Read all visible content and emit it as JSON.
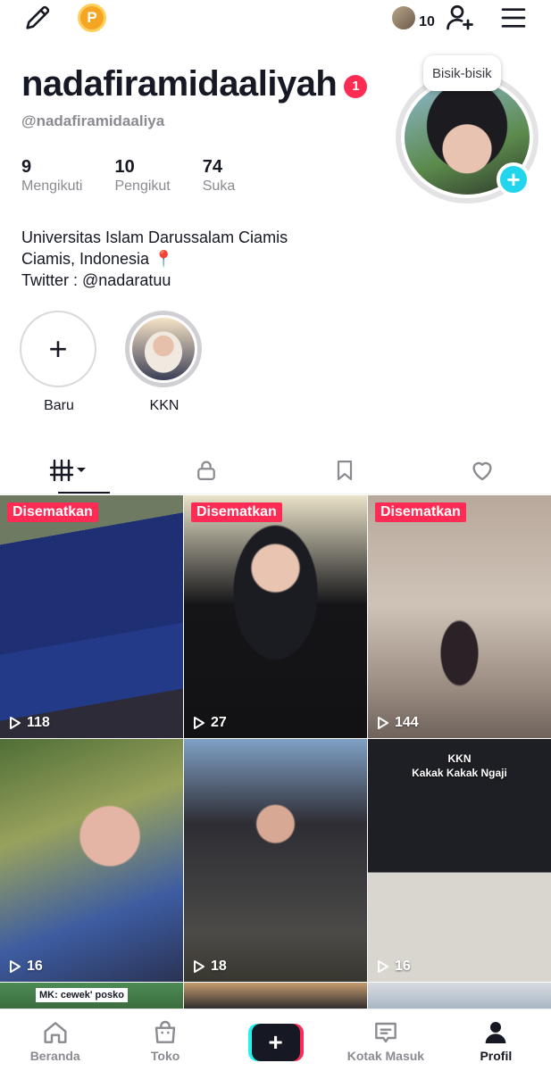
{
  "topbar": {
    "coin_letter": "P",
    "friends_count": "10"
  },
  "profile": {
    "username": "nadafiramidaaliyah",
    "username_badge": "1",
    "handle": "@nadafiramidaaliya",
    "bubble": "Bisik-bisik",
    "stats": [
      {
        "value": "9",
        "label": "Mengikuti"
      },
      {
        "value": "10",
        "label": "Pengikut"
      },
      {
        "value": "74",
        "label": "Suka"
      }
    ],
    "bio": [
      "Universitas Islam Darussalam Ciamis",
      "Ciamis, Indonesia 📍",
      "Twitter : @nadaratuu"
    ]
  },
  "highlights": [
    {
      "label": "Baru",
      "icon": "plus-icon"
    },
    {
      "label": "KKN",
      "icon": "photo"
    }
  ],
  "tabs": [
    "videos-grid-icon",
    "lock-icon",
    "bookmark-icon",
    "heart-icon"
  ],
  "videos": [
    {
      "pinned": "Disematkan",
      "views": "118",
      "overlay": ""
    },
    {
      "pinned": "Disematkan",
      "views": "27",
      "overlay": ""
    },
    {
      "pinned": "Disematkan",
      "views": "144",
      "overlay": ""
    },
    {
      "pinned": "",
      "views": "16",
      "overlay": ""
    },
    {
      "pinned": "",
      "views": "18",
      "overlay": ""
    },
    {
      "pinned": "",
      "views": "16",
      "overlay": "KKN\nKakak Kakak Ngaji"
    },
    {
      "pinned": "",
      "views": "",
      "overlay": "MK: cewek' posko"
    },
    {
      "pinned": "",
      "views": "",
      "overlay": ""
    },
    {
      "pinned": "",
      "views": "",
      "overlay": ""
    }
  ],
  "bottomnav": [
    {
      "label": "Beranda",
      "icon": "home-icon"
    },
    {
      "label": "Toko",
      "icon": "shop-bag-icon"
    },
    {
      "label": "",
      "icon": "create-plus-icon"
    },
    {
      "label": "Kotak Masuk",
      "icon": "inbox-icon"
    },
    {
      "label": "Profil",
      "icon": "profile-icon"
    }
  ],
  "colors": {
    "accent_red": "#fe2c55",
    "accent_cyan": "#20d5ec",
    "text_primary": "#161823",
    "text_secondary": "#8a8b91"
  }
}
